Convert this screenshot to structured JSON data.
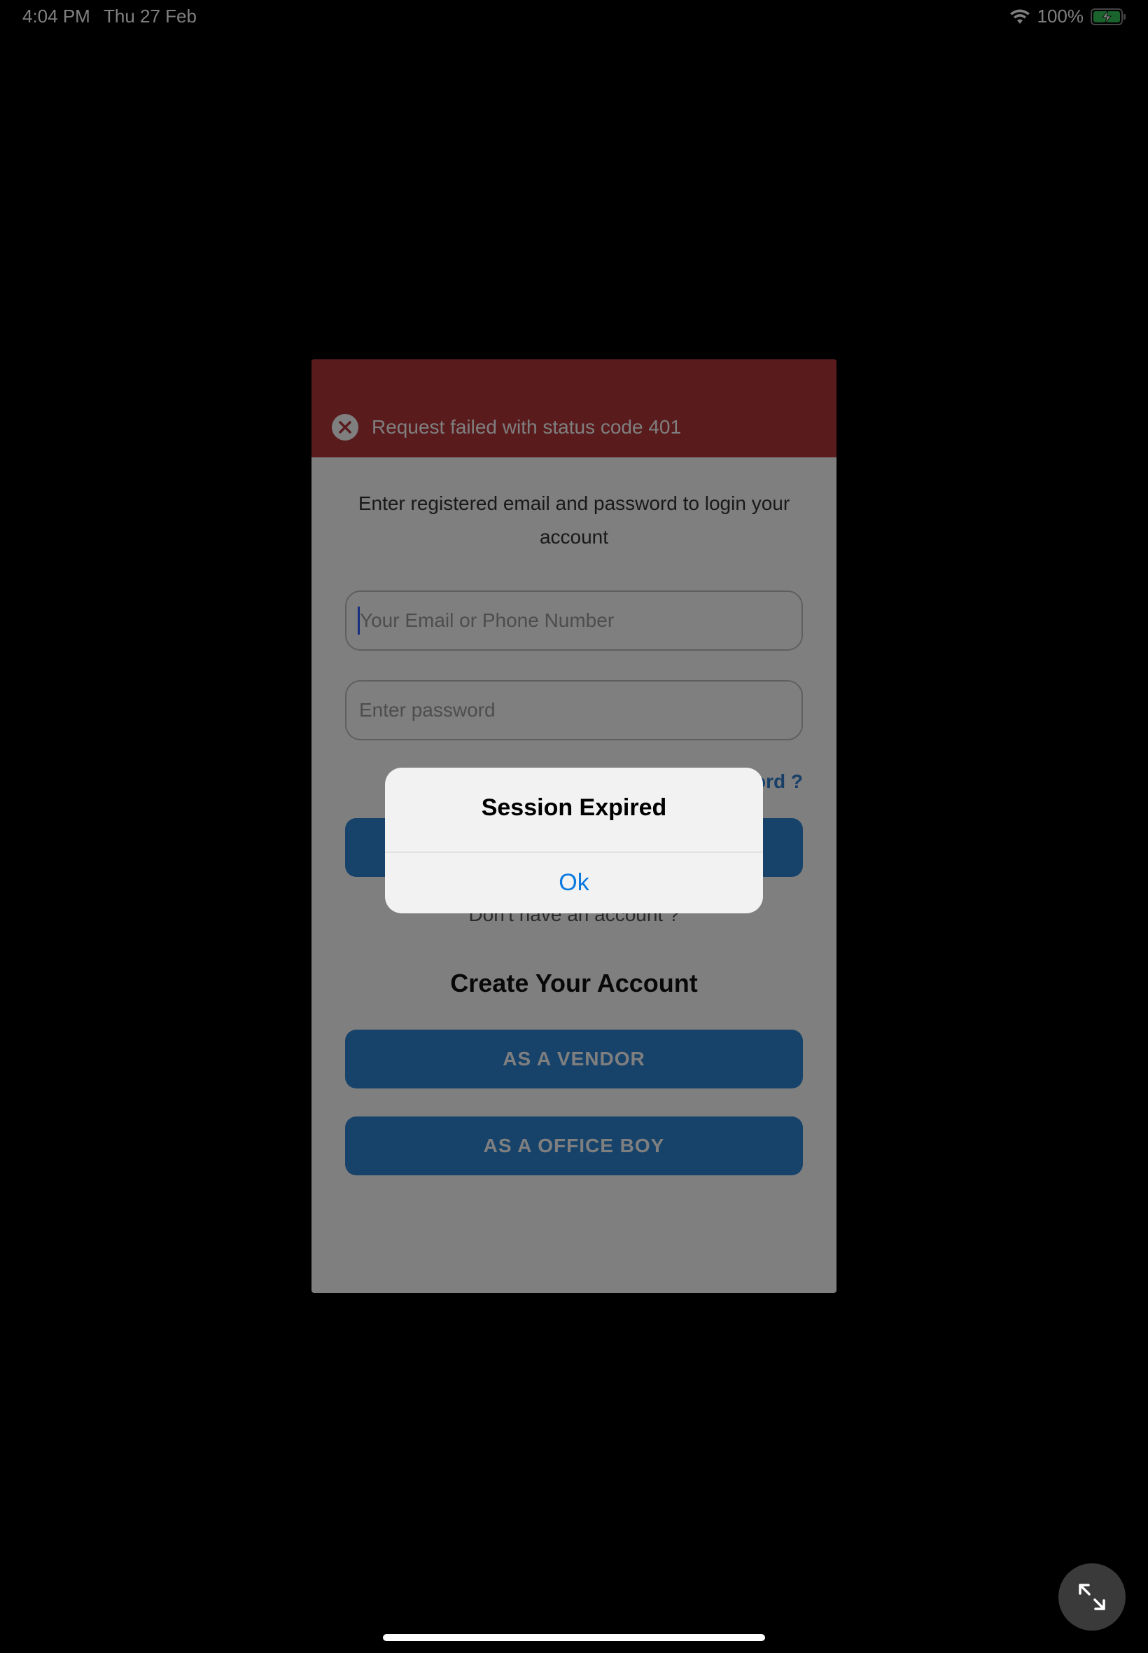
{
  "status_bar": {
    "time": "4:04 PM",
    "date": "Thu 27 Feb",
    "battery_percent": "100%"
  },
  "toast": {
    "message": "Request failed with status code 401",
    "icon": "close-circle-icon",
    "color": "#b5363a"
  },
  "login": {
    "subtitle": "Enter registered email and password to login your account",
    "email_placeholder": "Your Email or Phone Number",
    "password_placeholder": "Enter password",
    "forgot_password_partial": "ord ?",
    "no_account_text": "Don't have an account ?"
  },
  "create_account": {
    "heading": "Create Your Account",
    "vendor_button": "AS A VENDOR",
    "office_boy_button": "AS A OFFICE BOY"
  },
  "alert": {
    "title": "Session Expired",
    "ok_button": "Ok"
  },
  "colors": {
    "primary_button": "#2f86d6",
    "link": "#2f7fd0",
    "alert_button": "#0a7ae0"
  }
}
